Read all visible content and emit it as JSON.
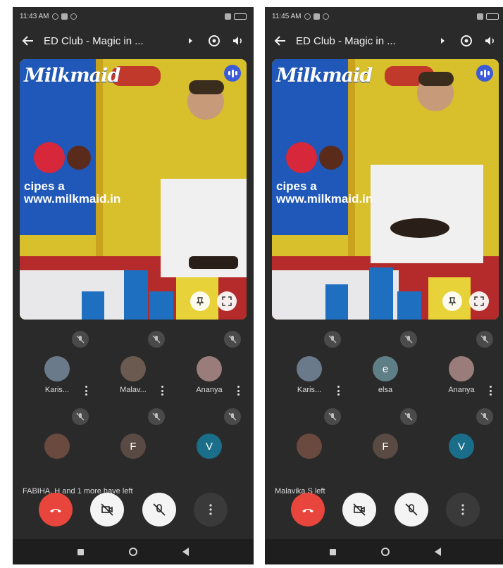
{
  "colors": {
    "background": "#2a2a2a",
    "end_call": "#e8453c",
    "speaking_badge": "#3d5bd6",
    "video_bg_yellow": "#d9c02a"
  },
  "screens": [
    {
      "status_time": "11:43 AM",
      "title": "ED Club - Magic in ...",
      "video": {
        "brand": "Milkmaid",
        "banner_line1": "cipes a",
        "banner_line2": "www.milkmaid.in"
      },
      "participants": [
        {
          "name": "Karis...",
          "avatar": "photo",
          "initial": "",
          "color": "#6b7a8a"
        },
        {
          "name": "Malav...",
          "avatar": "photo",
          "initial": "",
          "color": "#6a5a50"
        },
        {
          "name": "Ananya",
          "avatar": "photo",
          "initial": "",
          "color": "#9a7d7a"
        },
        {
          "name": "",
          "avatar": "photo",
          "initial": "",
          "color": "#6a4a3e"
        },
        {
          "name": "",
          "avatar": "letter",
          "initial": "F",
          "color": "#5a4a44"
        },
        {
          "name": "",
          "avatar": "letter",
          "initial": "V",
          "color": "#1a6e8a"
        }
      ],
      "left_message": "FABIHA. H and 1 more have left"
    },
    {
      "status_time": "11:45 AM",
      "title": "ED Club - Magic in ...",
      "video": {
        "brand": "Milkmaid",
        "banner_line1": "cipes a",
        "banner_line2": "www.milkmaid.in"
      },
      "participants": [
        {
          "name": "Karis...",
          "avatar": "photo",
          "initial": "",
          "color": "#6b7a8a"
        },
        {
          "name": "elsa",
          "avatar": "letter",
          "initial": "e",
          "color": "#5f7f86"
        },
        {
          "name": "Ananya",
          "avatar": "photo",
          "initial": "",
          "color": "#9a7d7a"
        },
        {
          "name": "",
          "avatar": "photo",
          "initial": "",
          "color": "#6a4a3e"
        },
        {
          "name": "",
          "avatar": "letter",
          "initial": "F",
          "color": "#5a4a44"
        },
        {
          "name": "",
          "avatar": "letter",
          "initial": "V",
          "color": "#1a6e8a"
        }
      ],
      "left_message": "Malavika S left"
    }
  ],
  "icons": {
    "back": "arrow-left-icon",
    "more_title": "chevron-right-icon",
    "switch_camera": "camera-switch-icon",
    "speaker": "speaker-icon",
    "mic_off": "mic-off-icon",
    "pin": "pin-icon",
    "fullscreen": "fullscreen-icon",
    "end_call": "phone-hangup-icon",
    "video_off": "video-off-icon",
    "more": "more-vert-icon"
  }
}
